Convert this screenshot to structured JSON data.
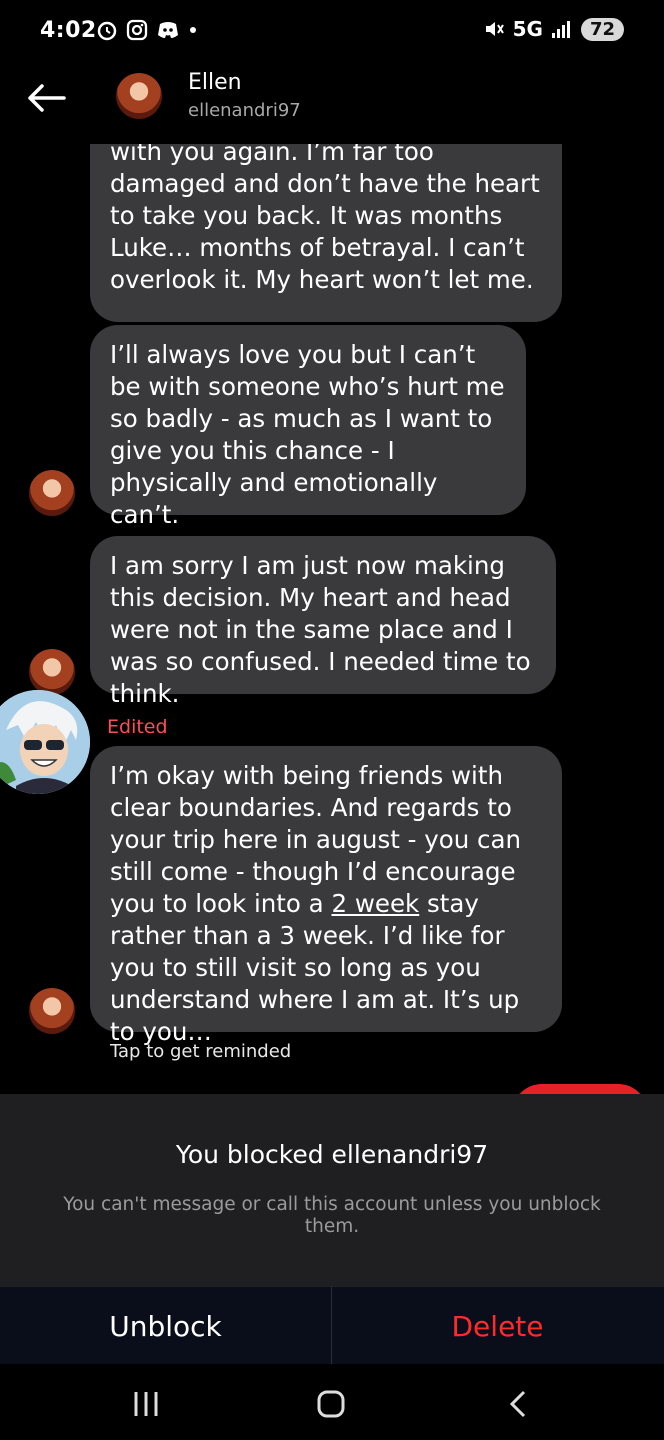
{
  "status_bar": {
    "time": "4:02",
    "network": "5G",
    "battery": "72"
  },
  "header": {
    "name": "Ellen",
    "username": "ellenandri97"
  },
  "messages": [
    {
      "text": "with you again. I’m far too damaged and don’t have the heart to take you back. It was months Luke… months of betrayal. I can’t overlook it. My heart won’t let me."
    },
    {
      "text": "I’ll always love you but I can’t be with someone who’s hurt me so badly - as much as I want to give you this chance - I physically and emotionally can’t."
    },
    {
      "text": "I am sorry I am just now making this decision. My heart and head were not in the same place and I was so confused. I needed time to think."
    },
    {
      "text_before": "I’m okay with being friends with clear boundaries. And regards to your trip here in august - you can still come - though I’d encourage you to look into a ",
      "link": "2 week",
      "text_after": " stay rather than a 3 week. I’d like for you to still visit so long as you understand where I am at. It’s up to you…"
    }
  ],
  "edited_label": "Edited",
  "reminder": "Tap to get reminded",
  "blocked": {
    "title": "You blocked ellenandri97",
    "description": "You can't message or call this account unless you unblock them."
  },
  "actions": {
    "unblock": "Unblock",
    "delete": "Delete"
  },
  "colors": {
    "bubble": "#3a3a3c",
    "delete": "#ff2a2a",
    "edited": "#ff4d57"
  }
}
